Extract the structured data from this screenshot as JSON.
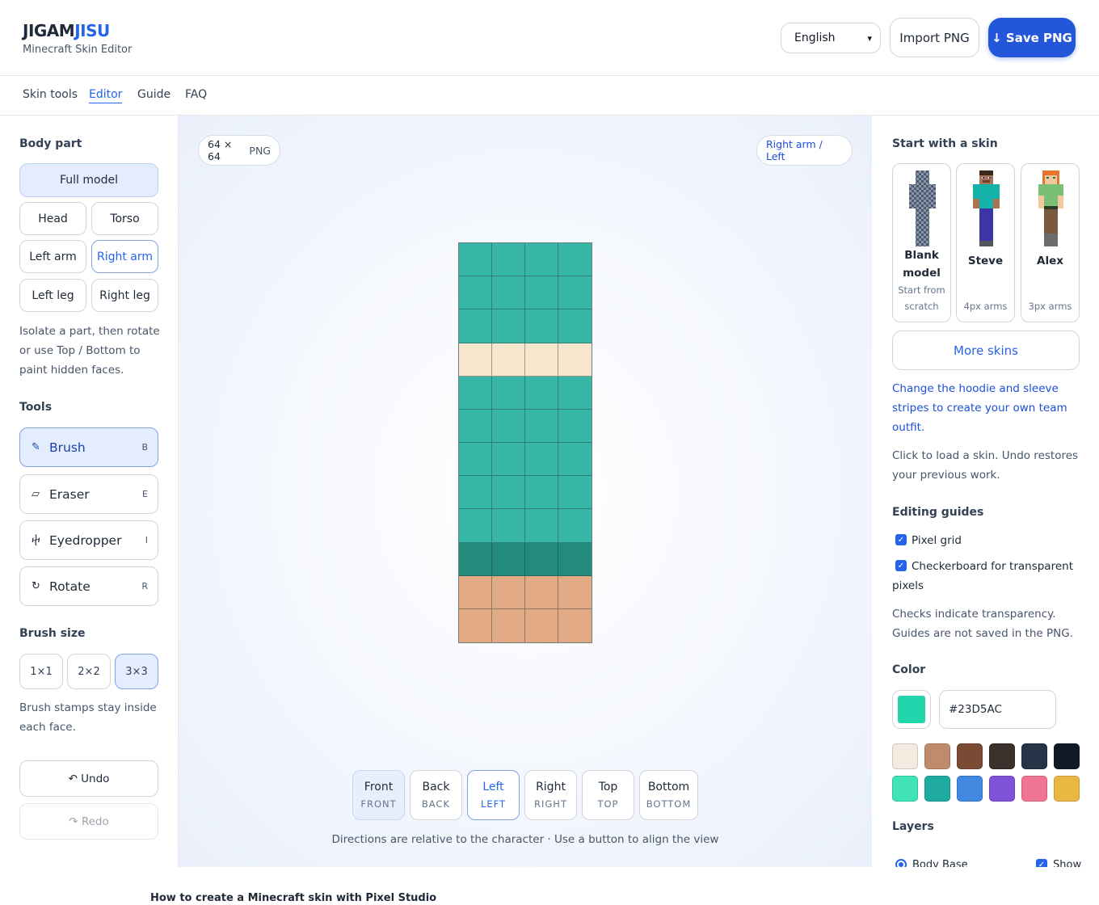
{
  "app": {
    "logo_part1": "JIGAM",
    "logo_part2": "JISU",
    "subtitle": "Minecraft Skin Editor",
    "language": "English",
    "import_label": "Import PNG",
    "save_label": "↓ Save PNG"
  },
  "nav": {
    "items": [
      "Skin tools",
      "Editor",
      "Guide",
      "FAQ"
    ],
    "active": "Editor"
  },
  "left": {
    "body_part_title": "Body part",
    "parts": {
      "full": "Full model",
      "head": "Head",
      "torso": "Torso",
      "left_arm": "Left arm",
      "right_arm": "Right arm",
      "left_leg": "Left leg",
      "right_leg": "Right leg"
    },
    "body_part_note": "Isolate a part, then rotate or use Top / Bottom to paint hidden faces.",
    "tools_title": "Tools",
    "tools": [
      {
        "label": "Brush",
        "key": "B",
        "icon": "brush-icon"
      },
      {
        "label": "Eraser",
        "key": "E",
        "icon": "eraser-icon"
      },
      {
        "label": "Eyedropper",
        "key": "I",
        "icon": "eyedropper-icon"
      },
      {
        "label": "Rotate",
        "key": "R",
        "icon": "rotate-icon"
      }
    ],
    "brush_size_title": "Brush size",
    "sizes": [
      "1×1",
      "2×2",
      "3×3"
    ],
    "selected_size": "3×3",
    "brush_note": "Brush stamps stay inside each face.",
    "undo_label": "↶ Undo",
    "redo_label": "↷ Redo"
  },
  "canvas": {
    "size_value": "64 × 64",
    "format": "PNG",
    "view_label": "Right arm / Left",
    "pixel_rows": [
      [
        "#38b7a8",
        "#38b7a8",
        "#38b7a8",
        "#38b7a8"
      ],
      [
        "#38b7a8",
        "#38b7a8",
        "#38b7a8",
        "#38b7a8"
      ],
      [
        "#38b7a8",
        "#38b7a8",
        "#38b7a8",
        "#38b7a8"
      ],
      [
        "#f5e6cd",
        "#f5e6cd",
        "#f5e6cd",
        "#f5e6cd"
      ],
      [
        "#38b7a8",
        "#38b7a8",
        "#38b7a8",
        "#38b7a8"
      ],
      [
        "#38b7a8",
        "#38b7a8",
        "#38b7a8",
        "#38b7a8"
      ],
      [
        "#38b7a8",
        "#38b7a8",
        "#38b7a8",
        "#38b7a8"
      ],
      [
        "#38b7a8",
        "#38b7a8",
        "#38b7a8",
        "#38b7a8"
      ],
      [
        "#38b7a8",
        "#38b7a8",
        "#38b7a8",
        "#38b7a8"
      ],
      [
        "#238a7c",
        "#238a7c",
        "#238a7c",
        "#238a7c"
      ],
      [
        "#e1a984",
        "#e1a984",
        "#e1a984",
        "#e1a984"
      ],
      [
        "#e1a984",
        "#e1a984",
        "#e1a984",
        "#e1a984"
      ]
    ],
    "views": [
      {
        "label": "Front",
        "sub": "FRONT"
      },
      {
        "label": "Back",
        "sub": "BACK"
      },
      {
        "label": "Left",
        "sub": "LEFT"
      },
      {
        "label": "Right",
        "sub": "RIGHT"
      },
      {
        "label": "Top",
        "sub": "TOP"
      },
      {
        "label": "Bottom",
        "sub": "BOTTOM"
      }
    ],
    "selected_view": "Left",
    "directions_note": "Directions are relative to the character · Use a button to align the view"
  },
  "right": {
    "start_title": "Start with a skin",
    "skins": [
      {
        "name": "Blank model",
        "desc": "Start from scratch"
      },
      {
        "name": "Steve",
        "desc": "4px arms"
      },
      {
        "name": "Alex",
        "desc": "3px arms"
      }
    ],
    "more_skins": "More skins",
    "promo": "Change the hoodie and sleeve stripes to create your own team outfit.",
    "load_note": "Click to load a skin. Undo restores your previous work.",
    "guides_title": "Editing guides",
    "guide_pixel_grid": "Pixel grid",
    "guide_checkerboard": "Checkerboard for transparent pixels",
    "guides_note": "Checks indicate transparency. Guides are not saved in the PNG.",
    "color_title": "Color",
    "current_color": "#23D5AC",
    "hex_value": "#23D5AC",
    "palette": [
      "#f3ebe0",
      "#c08a6e",
      "#7b4a35",
      "#3a302c",
      "#263447",
      "#111827",
      "#3fe3b5",
      "#1eaaa1",
      "#4287e0",
      "#7e54d9",
      "#ef7393",
      "#e9b843"
    ],
    "layers_title": "Layers",
    "layer_name": "Body Base",
    "layer_show": "Show"
  },
  "footer": {
    "title": "How to create a Minecraft skin with Pixel Studio"
  }
}
